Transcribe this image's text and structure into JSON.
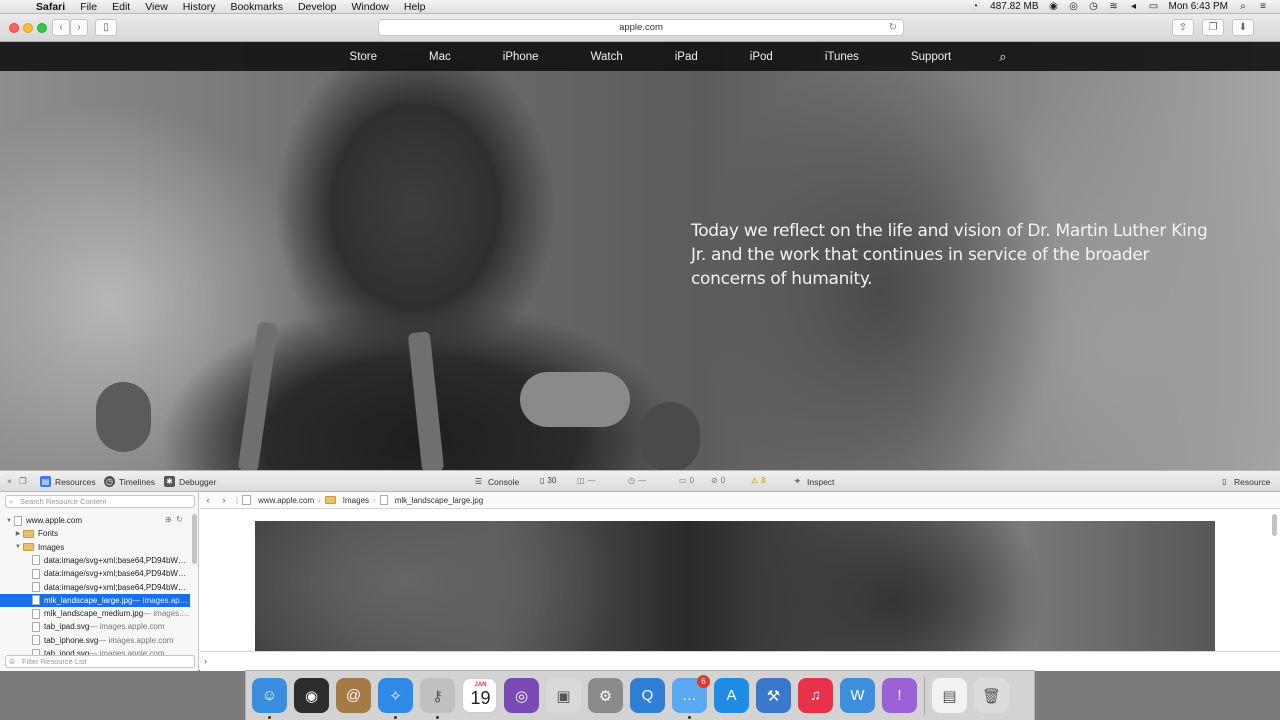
{
  "menubar": {
    "app_name": "Safari",
    "menus": [
      "File",
      "Edit",
      "View",
      "History",
      "Bookmarks",
      "Develop",
      "Window",
      "Help"
    ],
    "memory": "487.82 MB",
    "clock": "Mon 6:43 PM"
  },
  "safari": {
    "address": "apple.com"
  },
  "globalnav": {
    "links": [
      "Store",
      "Mac",
      "iPhone",
      "Watch",
      "iPad",
      "iPod",
      "iTunes",
      "Support"
    ]
  },
  "hero": {
    "text": "Today we reflect on the life and vision of Dr. Martin Luther King Jr. and the work that continues in service of the broader concerns of humanity."
  },
  "inspector": {
    "tabs": {
      "resources": "Resources",
      "timelines": "Timelines",
      "debugger": "Debugger",
      "console": "Console",
      "inspect": "Inspect",
      "resource": "Resource"
    },
    "counters": {
      "resources": "30",
      "size": "—",
      "time": "—",
      "logs": "0",
      "errors": "0",
      "warnings": "8"
    },
    "search_placeholder": "Search Resource Content",
    "filter_placeholder": "Filter Resource List",
    "tree": [
      {
        "name": "www.apple.com",
        "sub": "",
        "type": "root",
        "indent": 0
      },
      {
        "name": "Fonts",
        "sub": "",
        "type": "folder-collapsed",
        "indent": 1
      },
      {
        "name": "Images",
        "sub": "",
        "type": "folder-open",
        "indent": 1
      },
      {
        "name": "data:image/svg+xml;base64,PD94bWw…",
        "sub": "",
        "type": "file",
        "indent": 2
      },
      {
        "name": "data:image/svg+xml;base64,PD94bWw…",
        "sub": "",
        "type": "file",
        "indent": 2
      },
      {
        "name": "data:image/svg+xml;base64,PD94bWw…",
        "sub": "",
        "type": "file",
        "indent": 2
      },
      {
        "name": "mlk_landscape_large.jpg",
        "sub": " — images.ap…",
        "type": "file",
        "indent": 2,
        "selected": true
      },
      {
        "name": "mlk_landscape_medium.jpg",
        "sub": " — images.…",
        "type": "file",
        "indent": 2
      },
      {
        "name": "tab_ipad.svg",
        "sub": " — images.apple.com",
        "type": "file",
        "indent": 2
      },
      {
        "name": "tab_iphone.svg",
        "sub": " — images.apple.com",
        "type": "file",
        "indent": 2
      },
      {
        "name": "tab_ipod.svg",
        "sub": " — images.apple.com",
        "type": "file",
        "indent": 2
      }
    ],
    "breadcrumb": [
      "www.apple.com",
      "Images",
      "mlk_landscape_large.jpg"
    ],
    "console_prompt": "›"
  },
  "dock": {
    "apps": [
      {
        "name": "finder-icon",
        "color": "#3b8de0",
        "glyph": "☺",
        "running": true
      },
      {
        "name": "launchpad-icon",
        "color": "#2d2d2d",
        "glyph": "◉",
        "running": false
      },
      {
        "name": "contacts-icon",
        "color": "#a57a47",
        "glyph": "@",
        "running": false
      },
      {
        "name": "safari-icon",
        "color": "#2f8ae5",
        "glyph": "✧",
        "running": true
      },
      {
        "name": "keychain-icon",
        "color": "#c0c0c0",
        "glyph": "⚷",
        "running": true
      },
      {
        "name": "calendar-icon",
        "color": "#ffffff",
        "glyph": "",
        "running": false,
        "month": "JAN",
        "day": "19"
      },
      {
        "name": "instruments-icon",
        "color": "#7a4bb5",
        "glyph": "◎",
        "running": false
      },
      {
        "name": "preview-icon",
        "color": "#d9d9d9",
        "glyph": "▣",
        "running": false
      },
      {
        "name": "system-preferences-icon",
        "color": "#8a8a8a",
        "glyph": "⚙",
        "running": false
      },
      {
        "name": "quicktime-icon",
        "color": "#2f7fd4",
        "glyph": "Q",
        "running": false
      },
      {
        "name": "messages-icon",
        "color": "#5aa9f0",
        "glyph": "…",
        "running": true,
        "badge": "6"
      },
      {
        "name": "app-store-icon",
        "color": "#1f8ce6",
        "glyph": "A",
        "running": false
      },
      {
        "name": "xcode-icon",
        "color": "#3a78c9",
        "glyph": "⚒",
        "running": false
      },
      {
        "name": "itunes-icon",
        "color": "#e8324a",
        "glyph": "♫",
        "running": false
      },
      {
        "name": "word-icon",
        "color": "#3b8fdc",
        "glyph": "W",
        "running": false
      },
      {
        "name": "feedback-icon",
        "color": "#9b5fd6",
        "glyph": "!",
        "running": false
      }
    ],
    "extras": [
      {
        "name": "stack-icon",
        "color": "#f2f2f2",
        "glyph": "▤"
      },
      {
        "name": "trash-icon",
        "color": "#dcdcdc",
        "glyph": "🗑"
      }
    ]
  }
}
